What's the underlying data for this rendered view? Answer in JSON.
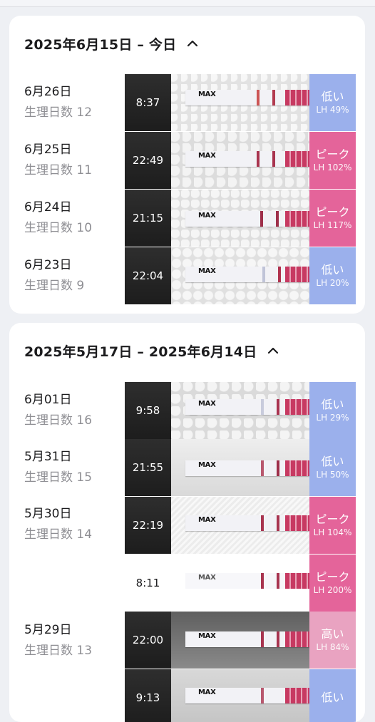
{
  "section1": {
    "header": "2025年6月15日 – 今日",
    "days": [
      {
        "date": "6月26日",
        "cycle": "生理日数 12"
      },
      {
        "date": "6月25日",
        "cycle": "生理日数 11"
      },
      {
        "date": "6月24日",
        "cycle": "生理日数 10"
      },
      {
        "date": "6月23日",
        "cycle": "生理日数 9"
      }
    ],
    "entries": [
      {
        "time": "8:37",
        "status": "低い",
        "lh": "LH 49%"
      },
      {
        "time": "22:49",
        "status": "ピーク",
        "lh": "LH 102%"
      },
      {
        "time": "21:15",
        "status": "ピーク",
        "lh": "LH 117%"
      },
      {
        "time": "22:04",
        "status": "低い",
        "lh": "LH 20%"
      }
    ]
  },
  "section2": {
    "header": "2025年5月17日 – 2025年6月14日",
    "days": [
      {
        "date": "6月01日",
        "cycle": "生理日数 16"
      },
      {
        "date": "5月31日",
        "cycle": "生理日数 15"
      },
      {
        "date": "5月30日",
        "cycle": "生理日数 14"
      },
      {
        "date": "5月29日",
        "cycle": "生理日数 13"
      }
    ],
    "entries": [
      {
        "time": "9:58",
        "status": "低い",
        "lh": "LH 29%"
      },
      {
        "time": "21:55",
        "status": "低い",
        "lh": "LH 50%"
      },
      {
        "time": "22:19",
        "status": "ピーク",
        "lh": "LH 104%"
      },
      {
        "time": "8:11",
        "status": "ピーク",
        "lh": "LH 200%"
      },
      {
        "time": "22:00",
        "status": "高い",
        "lh": "LH 84%"
      },
      {
        "time": "9:13",
        "status": "低い",
        "lh": ""
      }
    ]
  },
  "strip_label": "MAX",
  "colors": {
    "low": "#9bb0ec",
    "peak": "#e4649a",
    "high": "#e9a3c1"
  },
  "icons": {
    "collapse": "chevron-up-icon"
  }
}
